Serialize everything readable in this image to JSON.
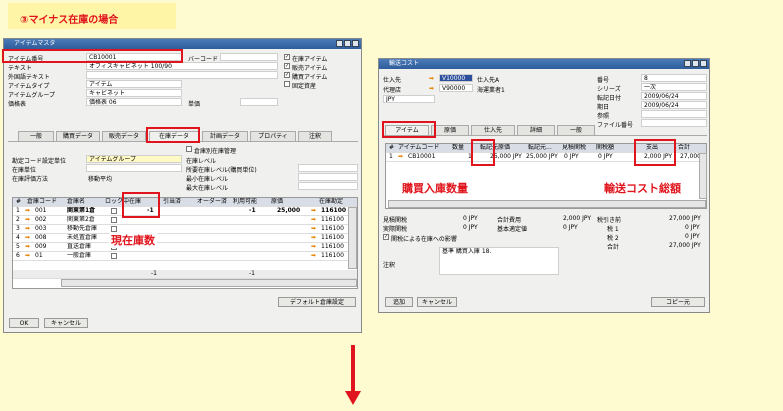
{
  "banner": {
    "title": "③マイナス在庫の場合"
  },
  "item_master": {
    "title": "アイテムマスタ",
    "fields": {
      "item_no_label": "アイテム番号",
      "item_no": "CB10001",
      "text_label": "テキスト",
      "text": "オフィスキャビネット 100/90",
      "foreign_text_label": "外国語テキスト",
      "item_type_label": "アイテムタイプ",
      "item_type": "アイテム",
      "item_group_label": "アイテムグループ",
      "item_group": "キャビネット",
      "price_list_label": "価格表",
      "price_list": "価格表 06",
      "unit_price_label": "単価",
      "barcode_label": "バーコード"
    },
    "checks": {
      "stock_item": "在庫アイテム",
      "sales_item": "販売アイテム",
      "purchase_item": "購買アイテム",
      "fixed_asset": "固定資産"
    },
    "tabs": [
      "一般",
      "購買データ",
      "販売データ",
      "在庫データ",
      "計画データ",
      "プロパティ",
      "注釈"
    ],
    "inventory": {
      "manage_by_wh": "倉庫別在庫管理",
      "gl_method_label": "勘定コード設定単位",
      "gl_method": "アイテムグループ",
      "uom_label": "在庫単位",
      "valuation_label": "在庫評価方法",
      "valuation": "移動平均",
      "req_label": "在庫レベル",
      "req_min": "所要在庫レベル(購買単位)",
      "min_label": "最小在庫レベル",
      "max_label": "最大在庫レベル"
    },
    "grid": {
      "headers": [
        "#",
        "倉庫コード",
        "倉庫名",
        "ロック中",
        "在庫",
        "引当済",
        "オーダー済",
        "利用可能",
        "原価",
        "在庫勘定"
      ],
      "rows": [
        {
          "no": "1",
          "code": "001",
          "name": "関東第1倉",
          "stock": "-1",
          "available": "-1",
          "cost": "25,000",
          "acct": "116100"
        },
        {
          "no": "2",
          "code": "002",
          "name": "関東第2倉",
          "stock": "",
          "available": "",
          "cost": "",
          "acct": "116100"
        },
        {
          "no": "3",
          "code": "003",
          "name": "移動先倉庫",
          "stock": "",
          "available": "",
          "cost": "",
          "acct": "116100"
        },
        {
          "no": "4",
          "code": "008",
          "name": "未処置倉庫",
          "stock": "",
          "available": "",
          "cost": "",
          "acct": "116100"
        },
        {
          "no": "5",
          "code": "009",
          "name": "直送倉庫",
          "stock": "",
          "available": "",
          "cost": "",
          "acct": "116100"
        },
        {
          "no": "6",
          "code": "01",
          "name": "一般倉庫",
          "stock": "",
          "available": "",
          "cost": "",
          "acct": "116100"
        }
      ],
      "total_stock": "-1",
      "total_available": "-1"
    },
    "default_wh_button": "デフォルト倉庫設定",
    "ok_button": "OK",
    "cancel_button": "キャンセル",
    "callout": "現在庫数"
  },
  "landed_cost": {
    "title": "輸送コスト",
    "vendor_label": "仕入先",
    "vendor_code": "V10000",
    "vendor_name": "仕入先A",
    "agent_label": "代理店",
    "agent_code": "V90000",
    "agent_name": "海運業者1",
    "currency": "JPY",
    "no_label": "番号",
    "no": "8",
    "series_label": "シリーズ",
    "series": "一次",
    "posting_label": "転記日付",
    "posting": "2009/06/24",
    "due_label": "期日",
    "due": "2009/06/24",
    "ref_label": "参照",
    "file_label": "ファイル番号",
    "tabs": [
      "アイテム",
      "原価",
      "仕入先",
      "詳細",
      "一般"
    ],
    "grid": {
      "headers": [
        "#",
        "アイテムコード",
        "数量",
        "転記元原価",
        "転記元...",
        "見積関税",
        "関税額",
        "支出",
        "合計"
      ],
      "row": {
        "no": "1",
        "code": "CB10001",
        "qty": "1",
        "base_price": "25,000 JPY",
        "base2": "25,000 JPY",
        "est_duty": "0 JPY",
        "duty": "0 JPY",
        "spend": "2,000 JPY",
        "total": "27,000"
      }
    },
    "summary": {
      "est_duty_label": "見積関税",
      "est_duty": "0 JPY",
      "actual_duty_label": "実際関税",
      "actual_duty": "0 JPY",
      "total_cost_label": "合計費用",
      "total_cost": "2,000 JPY",
      "base_label": "基本適定値",
      "base": "0 JPY",
      "pre_tax_label": "税引き前",
      "pre_tax": "27,000 JPY",
      "tax1_label": "税 1",
      "tax1": "0 JPY",
      "tax2_label": "税 2",
      "tax2": "0 JPY",
      "grand_label": "合計",
      "grand": "27,000 JPY",
      "impact_label": "関税による在庫への影響",
      "notes_label": "注釈",
      "notes": "基準 購買入庫 18."
    },
    "add_button": "追加",
    "cancel_button": "キャンセル",
    "copy_to_button": "コピー元",
    "callout_qty": "購買入庫数量",
    "callout_cost": "輸送コスト総額"
  }
}
